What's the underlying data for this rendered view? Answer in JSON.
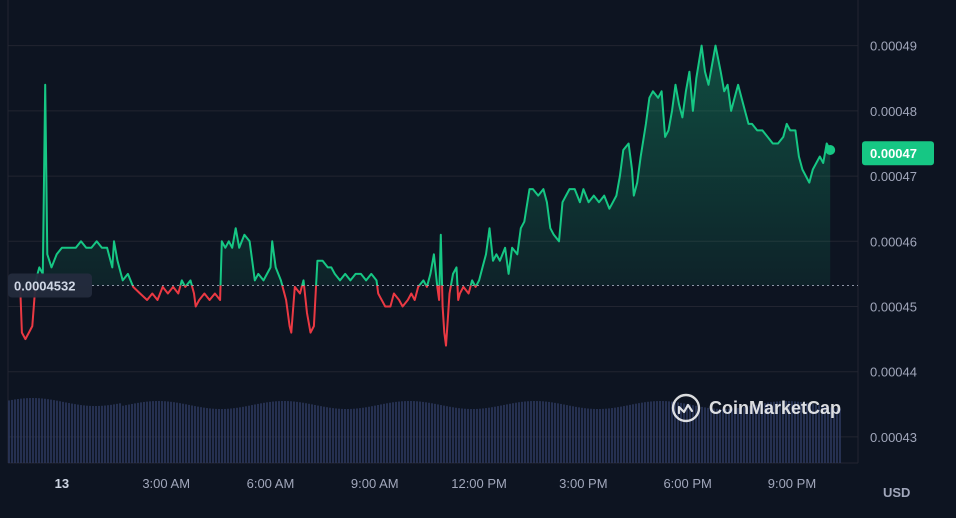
{
  "chart_data": {
    "type": "line",
    "currency": "USD",
    "ylim": [
      0.000426,
      0.000497
    ],
    "y_ticks": [
      "0.00043",
      "0.00044",
      "0.00045",
      "0.00046",
      "0.00047",
      "0.00048",
      "0.00049"
    ],
    "y_tick_values": [
      0.00043,
      0.00044,
      0.00045,
      0.00046,
      0.00047,
      0.00048,
      0.00049
    ],
    "x_ticks": [
      "13",
      "3:00 AM",
      "6:00 AM",
      "9:00 AM",
      "12:00 PM",
      "3:00 PM",
      "6:00 PM",
      "9:00 PM"
    ],
    "x_tick_hours": [
      0,
      3,
      6,
      9,
      12,
      15,
      18,
      21
    ],
    "xlim_hours": [
      -1.55,
      22.9
    ],
    "open_price": 0.00045322,
    "open_label": "0.0004532",
    "current_price": 0.0004735,
    "current_label": "0.00047",
    "colors": {
      "up": "#16c784",
      "down": "#ea3943",
      "background": "#0d1421",
      "grid": "#222531",
      "volume": "#2e3a60"
    },
    "watermark": "CoinMarketCap",
    "grid": true,
    "price_series": [
      [
        -1.2,
        0.000453
      ],
      [
        -1.15,
        0.000446
      ],
      [
        -1.05,
        0.000445
      ],
      [
        -0.95,
        0.000446
      ],
      [
        -0.85,
        0.000447
      ],
      [
        -0.75,
        0.000454
      ],
      [
        -0.65,
        0.000456
      ],
      [
        -0.55,
        0.000455
      ],
      [
        -0.48,
        0.000484
      ],
      [
        -0.42,
        0.000458
      ],
      [
        -0.3,
        0.000456
      ],
      [
        -0.15,
        0.000458
      ],
      [
        0.0,
        0.000459
      ],
      [
        0.2,
        0.000459
      ],
      [
        0.4,
        0.000459
      ],
      [
        0.55,
        0.00046
      ],
      [
        0.7,
        0.000459
      ],
      [
        0.85,
        0.000459
      ],
      [
        1.0,
        0.00046
      ],
      [
        1.15,
        0.000459
      ],
      [
        1.3,
        0.000459
      ],
      [
        1.45,
        0.000456
      ],
      [
        1.5,
        0.00046
      ],
      [
        1.6,
        0.000457
      ],
      [
        1.75,
        0.000454
      ],
      [
        1.9,
        0.000455
      ],
      [
        2.05,
        0.000453
      ],
      [
        2.25,
        0.000452
      ],
      [
        2.45,
        0.000451
      ],
      [
        2.6,
        0.000452
      ],
      [
        2.75,
        0.000451
      ],
      [
        2.9,
        0.000453
      ],
      [
        3.05,
        0.000452
      ],
      [
        3.2,
        0.000453
      ],
      [
        3.35,
        0.000452
      ],
      [
        3.45,
        0.000454
      ],
      [
        3.55,
        0.000453
      ],
      [
        3.7,
        0.000454
      ],
      [
        3.8,
        0.000452
      ],
      [
        3.85,
        0.00045
      ],
      [
        3.95,
        0.000451
      ],
      [
        4.1,
        0.000452
      ],
      [
        4.25,
        0.000451
      ],
      [
        4.4,
        0.000452
      ],
      [
        4.55,
        0.000451
      ],
      [
        4.6,
        0.00046
      ],
      [
        4.7,
        0.000459
      ],
      [
        4.8,
        0.00046
      ],
      [
        4.9,
        0.000459
      ],
      [
        5.0,
        0.000462
      ],
      [
        5.1,
        0.000459
      ],
      [
        5.25,
        0.000461
      ],
      [
        5.4,
        0.00046
      ],
      [
        5.5,
        0.000456
      ],
      [
        5.55,
        0.000454
      ],
      [
        5.65,
        0.000455
      ],
      [
        5.8,
        0.000454
      ],
      [
        5.9,
        0.000455
      ],
      [
        6.0,
        0.000456
      ],
      [
        6.05,
        0.00046
      ],
      [
        6.15,
        0.000456
      ],
      [
        6.3,
        0.000454
      ],
      [
        6.45,
        0.000451
      ],
      [
        6.55,
        0.000447
      ],
      [
        6.6,
        0.000446
      ],
      [
        6.7,
        0.000453
      ],
      [
        6.85,
        0.000452
      ],
      [
        6.95,
        0.000454
      ],
      [
        7.05,
        0.000449
      ],
      [
        7.15,
        0.000446
      ],
      [
        7.25,
        0.000447
      ],
      [
        7.35,
        0.000457
      ],
      [
        7.5,
        0.000457
      ],
      [
        7.65,
        0.000456
      ],
      [
        7.75,
        0.000456
      ],
      [
        7.85,
        0.000455
      ],
      [
        8.0,
        0.000454
      ],
      [
        8.15,
        0.000455
      ],
      [
        8.3,
        0.000454
      ],
      [
        8.45,
        0.000455
      ],
      [
        8.6,
        0.000455
      ],
      [
        8.75,
        0.000454
      ],
      [
        8.9,
        0.000455
      ],
      [
        9.05,
        0.000454
      ],
      [
        9.1,
        0.000452
      ],
      [
        9.2,
        0.000451
      ],
      [
        9.3,
        0.00045
      ],
      [
        9.45,
        0.00045
      ],
      [
        9.55,
        0.000452
      ],
      [
        9.7,
        0.000451
      ],
      [
        9.8,
        0.00045
      ],
      [
        9.95,
        0.000451
      ],
      [
        10.05,
        0.000452
      ],
      [
        10.15,
        0.000451
      ],
      [
        10.25,
        0.000453
      ],
      [
        10.4,
        0.000454
      ],
      [
        10.5,
        0.000453
      ],
      [
        10.6,
        0.000455
      ],
      [
        10.7,
        0.000458
      ],
      [
        10.8,
        0.000453
      ],
      [
        10.85,
        0.000451
      ],
      [
        10.9,
        0.000461
      ],
      [
        10.95,
        0.00045
      ],
      [
        11.0,
        0.000446
      ],
      [
        11.05,
        0.000444
      ],
      [
        11.1,
        0.000448
      ],
      [
        11.15,
        0.000452
      ],
      [
        11.25,
        0.000455
      ],
      [
        11.35,
        0.000456
      ],
      [
        11.4,
        0.000451
      ],
      [
        11.45,
        0.000452
      ],
      [
        11.55,
        0.000453
      ],
      [
        11.7,
        0.000452
      ],
      [
        11.8,
        0.000454
      ],
      [
        11.9,
        0.000453
      ],
      [
        12.0,
        0.000454
      ],
      [
        12.1,
        0.000456
      ],
      [
        12.2,
        0.000458
      ],
      [
        12.3,
        0.000462
      ],
      [
        12.4,
        0.000457
      ],
      [
        12.5,
        0.000458
      ],
      [
        12.6,
        0.000457
      ],
      [
        12.75,
        0.000459
      ],
      [
        12.85,
        0.000455
      ],
      [
        12.95,
        0.000459
      ],
      [
        13.1,
        0.000458
      ],
      [
        13.2,
        0.000462
      ],
      [
        13.3,
        0.000463
      ],
      [
        13.45,
        0.000468
      ],
      [
        13.55,
        0.000468
      ],
      [
        13.7,
        0.000467
      ],
      [
        13.85,
        0.000468
      ],
      [
        13.95,
        0.000466
      ],
      [
        14.05,
        0.000462
      ],
      [
        14.15,
        0.000461
      ],
      [
        14.3,
        0.00046
      ],
      [
        14.4,
        0.000466
      ],
      [
        14.5,
        0.000467
      ],
      [
        14.6,
        0.000468
      ],
      [
        14.75,
        0.000468
      ],
      [
        14.9,
        0.000466
      ],
      [
        15.0,
        0.000468
      ],
      [
        15.15,
        0.000466
      ],
      [
        15.3,
        0.000467
      ],
      [
        15.45,
        0.000466
      ],
      [
        15.6,
        0.000467
      ],
      [
        15.75,
        0.000465
      ],
      [
        15.85,
        0.000466
      ],
      [
        15.95,
        0.000467
      ],
      [
        16.05,
        0.00047
      ],
      [
        16.15,
        0.000474
      ],
      [
        16.3,
        0.000475
      ],
      [
        16.4,
        0.000471
      ],
      [
        16.45,
        0.000467
      ],
      [
        16.55,
        0.000469
      ],
      [
        16.65,
        0.000473
      ],
      [
        16.8,
        0.000478
      ],
      [
        16.9,
        0.000482
      ],
      [
        17.0,
        0.000483
      ],
      [
        17.15,
        0.000482
      ],
      [
        17.25,
        0.000483
      ],
      [
        17.35,
        0.000476
      ],
      [
        17.45,
        0.000477
      ],
      [
        17.55,
        0.00048
      ],
      [
        17.65,
        0.000484
      ],
      [
        17.75,
        0.000481
      ],
      [
        17.85,
        0.000479
      ],
      [
        17.95,
        0.000483
      ],
      [
        18.05,
        0.000486
      ],
      [
        18.15,
        0.00048
      ],
      [
        18.25,
        0.000485
      ],
      [
        18.4,
        0.00049
      ],
      [
        18.5,
        0.000486
      ],
      [
        18.6,
        0.000484
      ],
      [
        18.7,
        0.000487
      ],
      [
        18.8,
        0.00049
      ],
      [
        18.95,
        0.000486
      ],
      [
        19.05,
        0.000483
      ],
      [
        19.15,
        0.000484
      ],
      [
        19.25,
        0.00048
      ],
      [
        19.35,
        0.000482
      ],
      [
        19.45,
        0.000484
      ],
      [
        19.55,
        0.000482
      ],
      [
        19.65,
        0.00048
      ],
      [
        19.75,
        0.000478
      ],
      [
        19.85,
        0.000478
      ],
      [
        20.0,
        0.000477
      ],
      [
        20.15,
        0.000477
      ],
      [
        20.3,
        0.000476
      ],
      [
        20.45,
        0.000475
      ],
      [
        20.6,
        0.000475
      ],
      [
        20.75,
        0.000476
      ],
      [
        20.85,
        0.000478
      ],
      [
        20.95,
        0.000477
      ],
      [
        21.1,
        0.000477
      ],
      [
        21.2,
        0.000473
      ],
      [
        21.3,
        0.000471
      ],
      [
        21.4,
        0.00047
      ],
      [
        21.5,
        0.000469
      ],
      [
        21.6,
        0.000471
      ],
      [
        21.7,
        0.000472
      ],
      [
        21.8,
        0.000473
      ],
      [
        21.9,
        0.000472
      ],
      [
        22.0,
        0.000475
      ],
      [
        22.1,
        0.000474
      ]
    ]
  }
}
